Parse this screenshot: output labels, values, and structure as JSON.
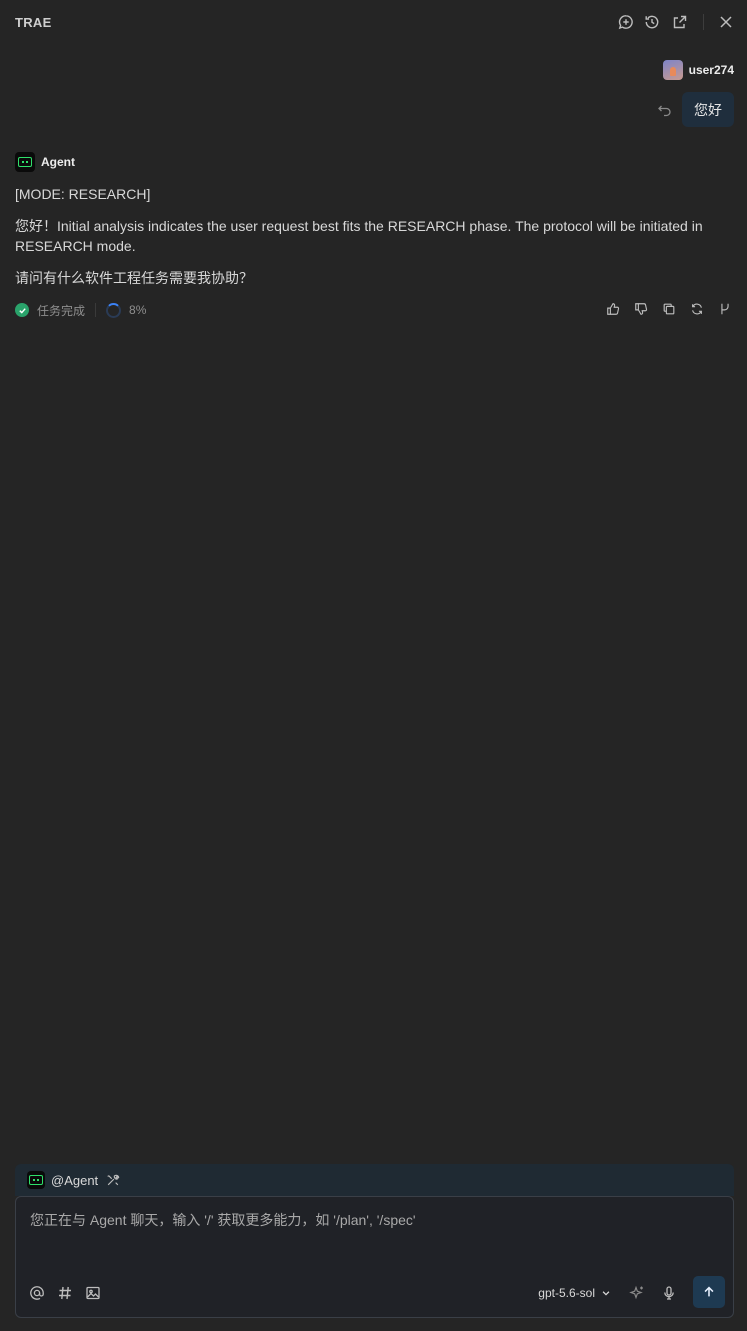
{
  "app": {
    "title": "TRAE"
  },
  "header_icons": [
    "new-chat-icon",
    "history-icon",
    "open-external-icon",
    "close-icon"
  ],
  "user": {
    "name": "user274",
    "message": "您好"
  },
  "agent": {
    "name": "Agent",
    "messages": [
      "[MODE: RESEARCH]",
      "您好！Initial analysis indicates the user request best fits the RESEARCH phase. The protocol will be initiated in RESEARCH mode.",
      "请问有什么软件工程任务需要我协助？"
    ],
    "status": "任务完成",
    "progress": "8%"
  },
  "feedback_icons": [
    "thumbs-up-icon",
    "thumbs-down-icon",
    "copy-icon",
    "regenerate-icon",
    "branch-icon"
  ],
  "composer": {
    "mention": "@Agent",
    "placeholder": "您正在与 Agent 聊天，输入 '/' 获取更多能力，如 '/plan', '/spec'",
    "model": "gpt-5.6-sol"
  },
  "colors": {
    "accent_green": "#2fe06a",
    "success": "#2aa36b",
    "send_button": "#1e3a52",
    "user_bubble": "#1f2e3d"
  }
}
